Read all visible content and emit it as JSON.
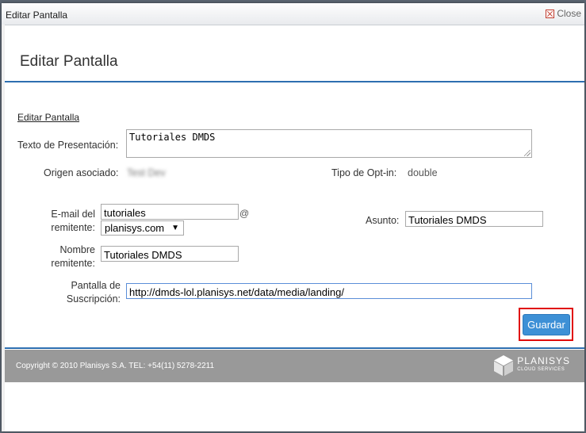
{
  "window": {
    "title": "Editar Pantalla",
    "close_label": "Close"
  },
  "header": {
    "title": "Editar Pantalla"
  },
  "section_title": "Editar Pantalla",
  "form": {
    "presentation_label": "Texto de Presentación:",
    "presentation_value": "Tutoriales DMDS",
    "origin_label": "Origen asociado:",
    "origin_value": "Test Dev",
    "optin_label": "Tipo de Opt-in:",
    "optin_value": "double",
    "email_label_1": "E-mail del",
    "email_label_2": "remitente:",
    "email_user": "tutoriales",
    "at_sign": "@",
    "email_domain": "planisys.com",
    "subject_label": "Asunto:",
    "subject_value": "Tutoriales DMDS",
    "sender_label_1": "Nombre",
    "sender_label_2": "remitente:",
    "sender_value": "Tutoriales DMDS",
    "subscription_label_1": "Pantalla de",
    "subscription_label_2": "Suscripción:",
    "subscription_value": "http://dmds-lol.planisys.net/data/media/landing/",
    "save_label": "Guardar"
  },
  "footer": {
    "copyright": "Copyright © 2010 Planisys S.A. TEL: +54(11) 5278-2211",
    "logo_name": "PLANISYS",
    "logo_sub": "CLOUD SERVICES"
  },
  "colors": {
    "accent": "#3d90d6",
    "rule": "#2d6fb0",
    "highlight": "#e00b0b",
    "footer_bg": "#999999"
  },
  "icons": {
    "close": "close-icon",
    "dropdown": "chevron-down-icon",
    "logo": "planisys-logo-icon",
    "resize": "resize-handle-icon"
  }
}
